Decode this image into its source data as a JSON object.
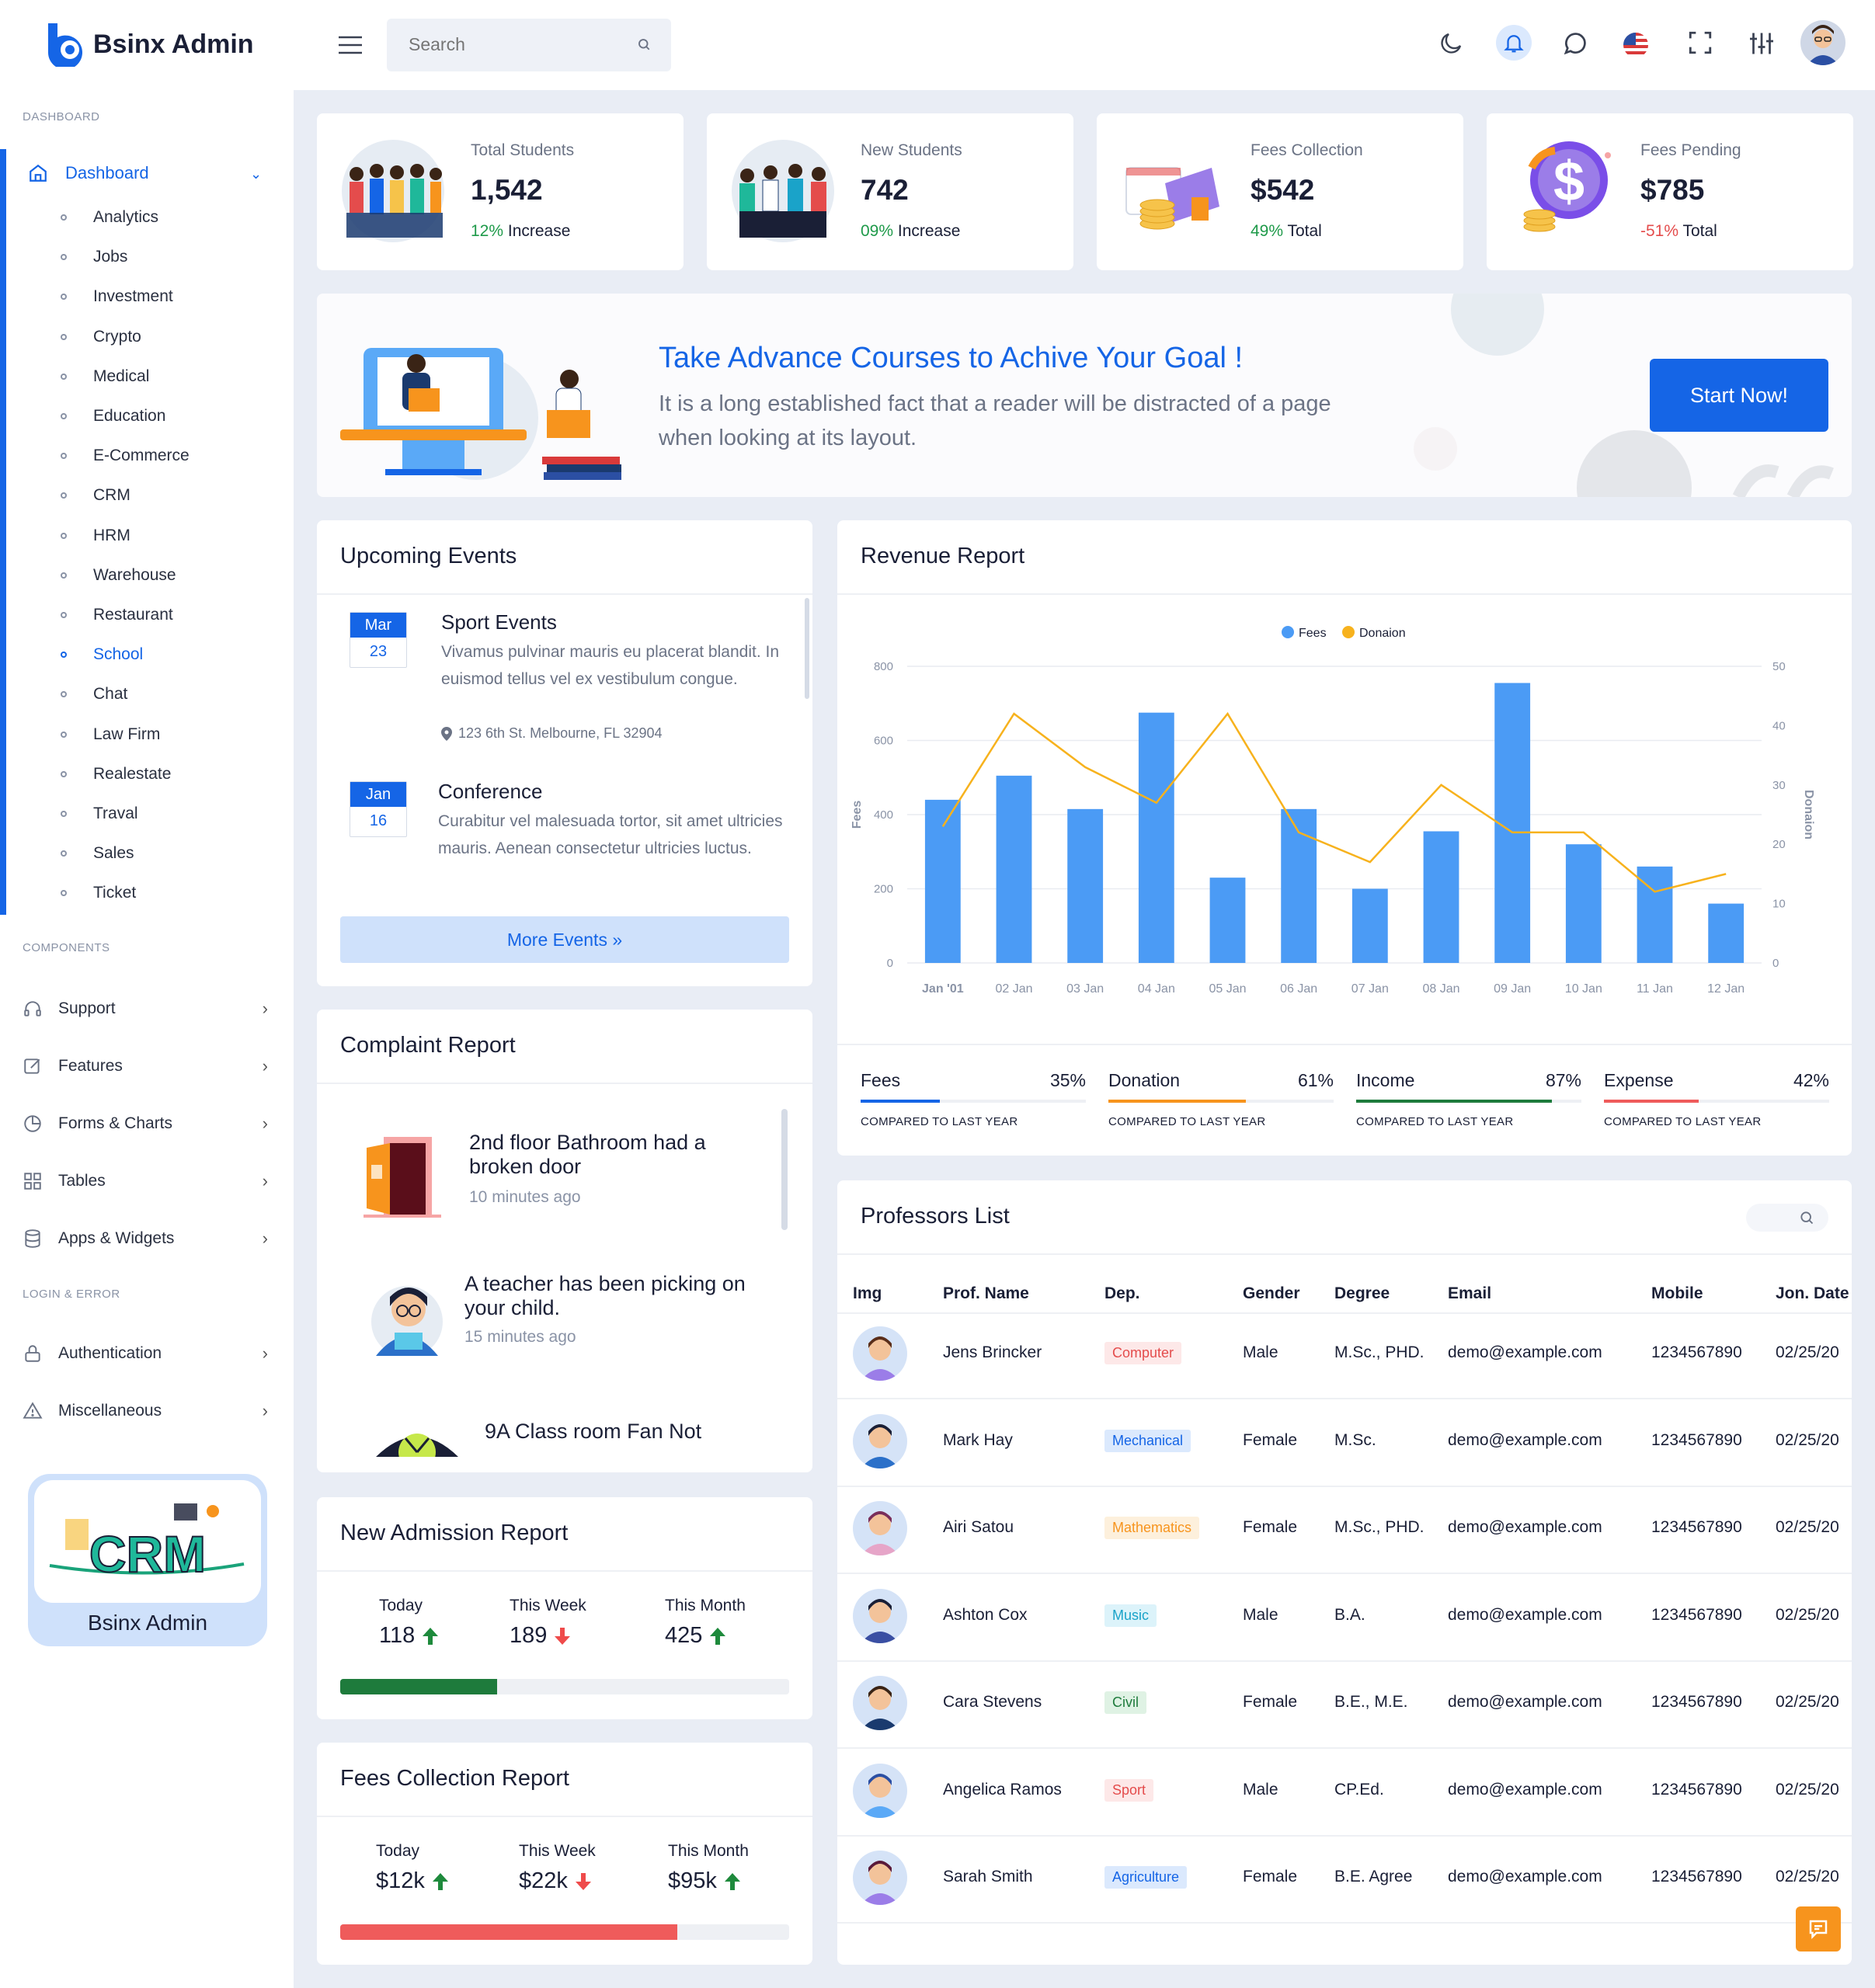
{
  "app": {
    "title": "Bsinx Admin"
  },
  "sidebar": {
    "section_dashboard": "DASHBOARD",
    "dashboard_label": "Dashboard",
    "sub_items": [
      "Analytics",
      "Jobs",
      "Investment",
      "Crypto",
      "Medical",
      "Education",
      "E-Commerce",
      "CRM",
      "HRM",
      "Warehouse",
      "Restaurant",
      "School",
      "Chat",
      "Law Firm",
      "Realestate",
      "Traval",
      "Sales",
      "Ticket"
    ],
    "active_item": "School",
    "section_components": "COMPONENTS",
    "components": [
      "Support",
      "Features",
      "Forms & Charts",
      "Tables",
      "Apps & Widgets"
    ],
    "section_login": "LOGIN & ERROR",
    "login_items": [
      "Authentication",
      "Miscellaneous"
    ],
    "promo_label": "Bsinx Admin",
    "promo_logo_text": "CRM"
  },
  "header": {
    "search_placeholder": "Search",
    "icons": [
      "menu-icon",
      "search-icon",
      "moon-icon",
      "bell-icon",
      "chat-icon",
      "us-flag-icon",
      "fullscreen-icon",
      "sliders-icon",
      "user-avatar"
    ]
  },
  "stats": [
    {
      "label": "Total Students",
      "value": "1,542",
      "change": "12%",
      "change_text": " Increase",
      "change_color": "#1f9a4a"
    },
    {
      "label": "New Students",
      "value": "742",
      "change": "09%",
      "change_text": " Increase",
      "change_color": "#1f9a4a"
    },
    {
      "label": "Fees Collection",
      "value": "$542",
      "change": "49%",
      "change_text": " Total",
      "change_color": "#1f9a4a"
    },
    {
      "label": "Fees Pending",
      "value": "$785",
      "change": "-51%",
      "change_text": " Total",
      "change_color": "#e44c4c"
    }
  ],
  "banner": {
    "title": "Take Advance Courses to Achive Your Goal !",
    "text": "It is a long established fact that a reader will be distracted of a page when looking at its layout.",
    "button": "Start Now!"
  },
  "events": {
    "title": "Upcoming Events",
    "items": [
      {
        "month": "Mar",
        "day": "23",
        "title": "Sport Events",
        "desc": "Vivamus pulvinar mauris eu placerat blandit. In euismod tellus vel ex vestibulum congue.",
        "location": "123 6th St. Melbourne, FL 32904"
      },
      {
        "month": "Jan",
        "day": "16",
        "title": "Conference",
        "desc": "Curabitur vel malesuada tortor, sit amet ultricies mauris. Aenean consectetur ultricies luctus."
      }
    ],
    "more_button": "More Events »"
  },
  "complaints": {
    "title": "Complaint Report",
    "items": [
      {
        "title": "2nd floor Bathroom had a broken door",
        "time": "10 minutes ago"
      },
      {
        "title": "A teacher has been picking on your child.",
        "time": "15 minutes ago"
      },
      {
        "title": "9A Class room Fan Not",
        "time": ""
      }
    ]
  },
  "admission": {
    "title": "New Admission Report",
    "today_label": "Today",
    "today_value": "118",
    "today_trend": "up",
    "week_label": "This Week",
    "week_value": "189",
    "week_trend": "down",
    "month_label": "This Month",
    "month_value": "425",
    "month_trend": "up",
    "progress": 0.35,
    "progress_color": "#1e7b3c"
  },
  "fees_report": {
    "title": "Fees Collection Report",
    "today_label": "Today",
    "today_value": "$12k",
    "today_trend": "up",
    "week_label": "This Week",
    "week_value": "$22k",
    "week_trend": "down",
    "month_label": "This Month",
    "month_value": "$95k",
    "month_trend": "up",
    "progress": 0.75,
    "progress_color": "#ef5b5b"
  },
  "revenue": {
    "title": "Revenue Report",
    "stats": [
      {
        "label": "Fees",
        "pct": "35%",
        "value": 0.35,
        "color": "#1565e6",
        "compare": "COMPARED TO LAST YEAR"
      },
      {
        "label": "Donation",
        "pct": "61%",
        "value": 0.61,
        "color": "#f7941d",
        "compare": "COMPARED TO LAST YEAR"
      },
      {
        "label": "Income",
        "pct": "87%",
        "value": 0.87,
        "color": "#1e7b3c",
        "compare": "COMPARED TO LAST YEAR"
      },
      {
        "label": "Expense",
        "pct": "42%",
        "value": 0.42,
        "color": "#ef5b5b",
        "compare": "COMPARED TO LAST YEAR"
      }
    ]
  },
  "chart_data": {
    "type": "bar",
    "categories": [
      "Jan '01",
      "02 Jan",
      "03 Jan",
      "04 Jan",
      "05 Jan",
      "06 Jan",
      "07 Jan",
      "08 Jan",
      "09 Jan",
      "10 Jan",
      "11 Jan",
      "12 Jan"
    ],
    "series": [
      {
        "name": "Fees",
        "type": "bar",
        "axis": "left",
        "color": "#4b9bf5",
        "values": [
          440,
          505,
          415,
          675,
          230,
          415,
          200,
          355,
          755,
          320,
          260,
          160
        ]
      },
      {
        "name": "Donaion",
        "type": "line",
        "axis": "right",
        "color": "#f7b21d",
        "values": [
          23,
          42,
          33,
          27,
          42,
          22,
          17,
          30,
          22,
          22,
          12,
          15
        ]
      }
    ],
    "ylabel": "Fees",
    "y2label": "Donaion",
    "ylim": [
      0,
      800
    ],
    "y2lim": [
      0,
      50
    ],
    "yticks": [
      0,
      200,
      400,
      600,
      800
    ],
    "y2ticks": [
      0,
      10,
      20,
      30,
      40,
      50
    ],
    "legend": "top-center",
    "grid": true
  },
  "professors": {
    "title": "Professors List",
    "columns": [
      "Img",
      "Prof. Name",
      "Dep.",
      "Gender",
      "Degree",
      "Email",
      "Mobile",
      "Jon. Date"
    ],
    "rows": [
      {
        "name": "Jens Brincker",
        "dept": "Computer",
        "dept_color": "#e44c4c",
        "dept_bg": "#fde8e8",
        "gender": "Male",
        "degree": "M.Sc., PHD.",
        "email": "demo@example.com",
        "mobile": "1234567890",
        "date": "02/25/20"
      },
      {
        "name": "Mark Hay",
        "dept": "Mechanical",
        "dept_color": "#1565e6",
        "dept_bg": "#dbe9fd",
        "gender": "Female",
        "degree": "M.Sc.",
        "email": "demo@example.com",
        "mobile": "1234567890",
        "date": "02/25/20"
      },
      {
        "name": "Airi Satou",
        "dept": "Mathematics",
        "dept_color": "#f7941d",
        "dept_bg": "#fdf0dc",
        "gender": "Female",
        "degree": "M.Sc., PHD.",
        "email": "demo@example.com",
        "mobile": "1234567890",
        "date": "02/25/20"
      },
      {
        "name": "Ashton Cox",
        "dept": "Music",
        "dept_color": "#1aa3c9",
        "dept_bg": "#dcf3fa",
        "gender": "Male",
        "degree": "B.A.",
        "email": "demo@example.com",
        "mobile": "1234567890",
        "date": "02/25/20"
      },
      {
        "name": "Cara Stevens",
        "dept": "Civil",
        "dept_color": "#1e7b3c",
        "dept_bg": "#dff2e4",
        "gender": "Female",
        "degree": "B.E., M.E.",
        "email": "demo@example.com",
        "mobile": "1234567890",
        "date": "02/25/20"
      },
      {
        "name": "Angelica Ramos",
        "dept": "Sport",
        "dept_color": "#e44c4c",
        "dept_bg": "#fde8e8",
        "gender": "Male",
        "degree": "CP.Ed.",
        "email": "demo@example.com",
        "mobile": "1234567890",
        "date": "02/25/20"
      },
      {
        "name": "Sarah Smith",
        "dept": "Agriculture",
        "dept_color": "#1565e6",
        "dept_bg": "#dbe9fd",
        "gender": "Female",
        "degree": "B.E. Agree",
        "email": "demo@example.com",
        "mobile": "1234567890",
        "date": "02/25/20"
      }
    ]
  }
}
